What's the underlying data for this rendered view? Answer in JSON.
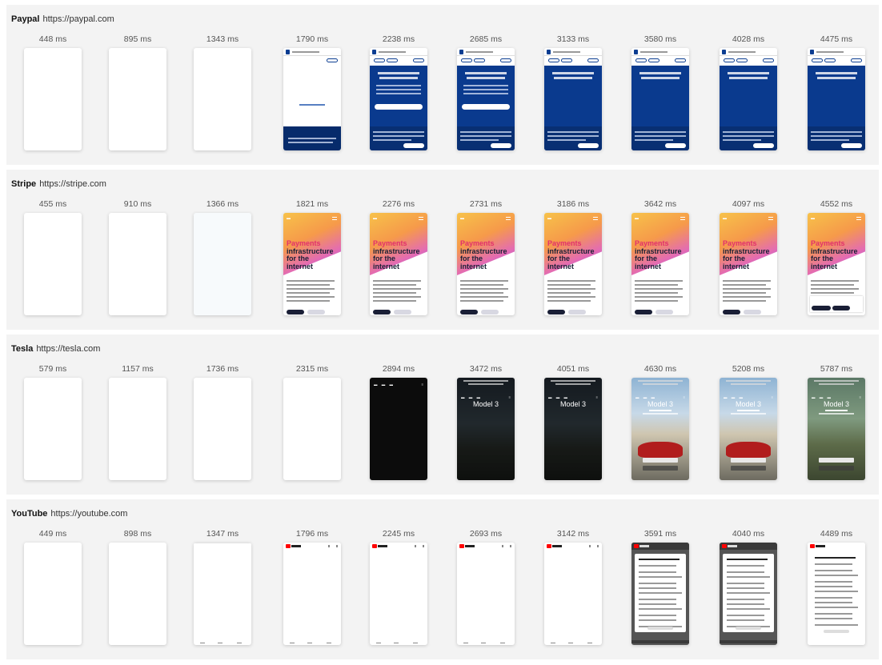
{
  "sections": [
    {
      "name": "Paypal",
      "url": "https://paypal.com",
      "times": [
        "448 ms",
        "895 ms",
        "1343 ms",
        "1790 ms",
        "2238 ms",
        "2685 ms",
        "3133 ms",
        "3580 ms",
        "4028 ms",
        "4475 ms"
      ]
    },
    {
      "name": "Stripe",
      "url": "https://stripe.com",
      "times": [
        "455 ms",
        "910 ms",
        "1366 ms",
        "1821 ms",
        "2276 ms",
        "2731 ms",
        "3186 ms",
        "3642 ms",
        "4097 ms",
        "4552 ms"
      ],
      "hero_lines": [
        "Payments",
        "infrastructure",
        "for the",
        "internet"
      ]
    },
    {
      "name": "Tesla",
      "url": "https://tesla.com",
      "times": [
        "579 ms",
        "1157 ms",
        "1736 ms",
        "2315 ms",
        "2894 ms",
        "3472 ms",
        "4051 ms",
        "4630 ms",
        "5208 ms",
        "5787 ms"
      ],
      "model_label": "Model 3"
    },
    {
      "name": "YouTube",
      "url": "https://youtube.com",
      "times": [
        "449 ms",
        "898 ms",
        "1347 ms",
        "1796 ms",
        "2245 ms",
        "2693 ms",
        "3142 ms",
        "3591 ms",
        "4040 ms",
        "4489 ms"
      ]
    }
  ],
  "colors": {
    "section_bg": "#f3f3f3",
    "paypal_blue": "#0a3a8e",
    "tesla_red": "#b11d1d",
    "youtube_red": "#ff0000"
  }
}
